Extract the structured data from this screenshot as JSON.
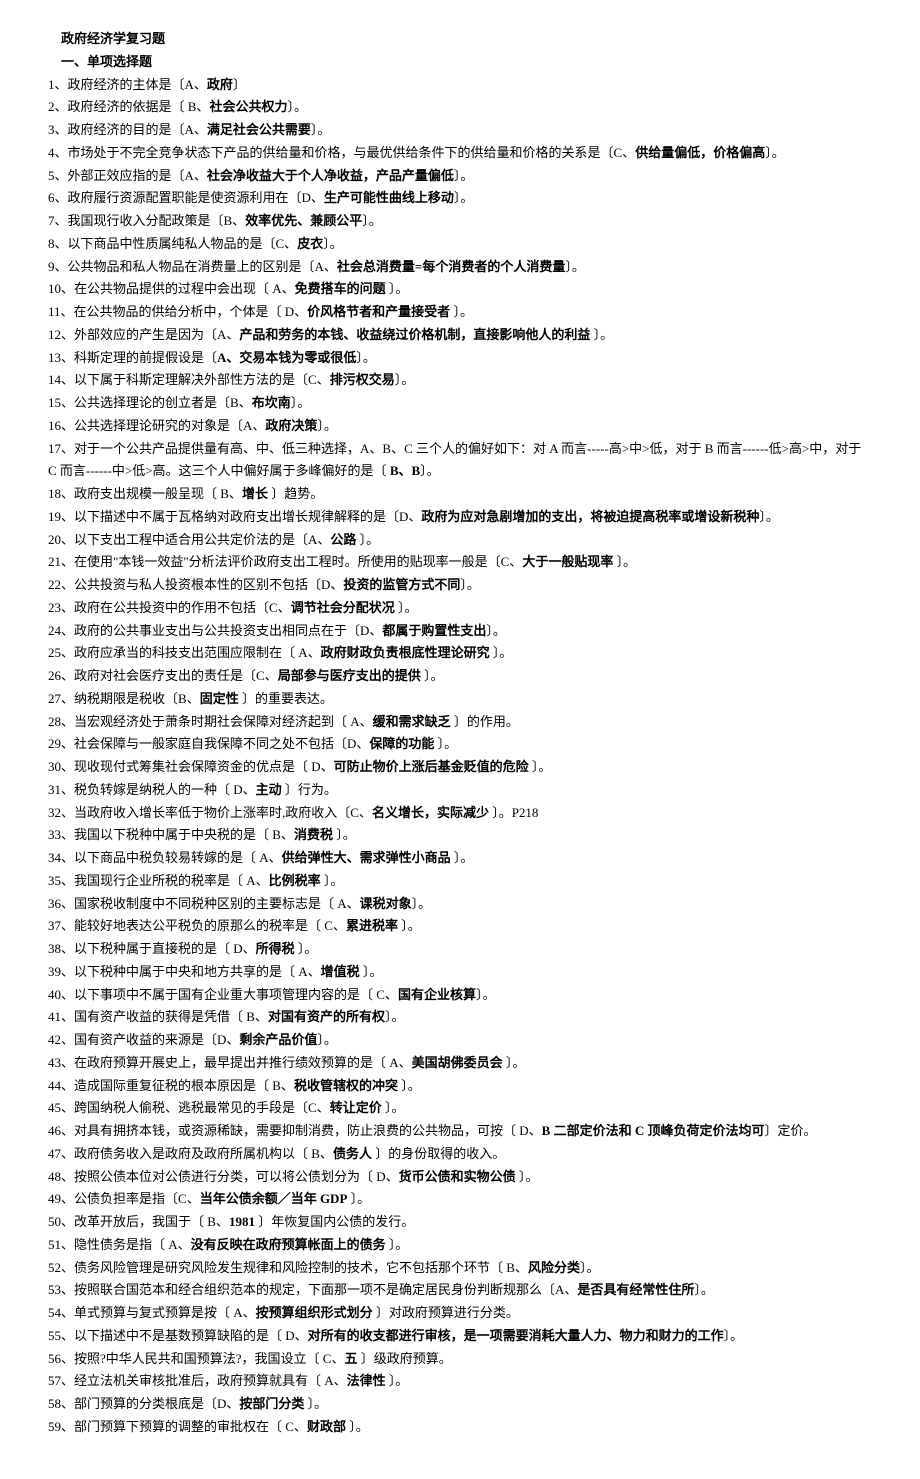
{
  "title": "政府经济学复习题",
  "section1": "一、单项选择题",
  "questions": [
    {
      "n": "1、",
      "pre": "政府经济的主体是〔A、",
      "ans": "政府",
      "post": "〕"
    },
    {
      "n": "2、",
      "pre": "政府经济的依据是〔  B、",
      "ans": "社会公共权力",
      "post": "〕。"
    },
    {
      "n": "3、",
      "pre": "政府经济的目的是〔A、",
      "ans": "满足社会公共需要",
      "post": "〕。"
    },
    {
      "n": "4、",
      "pre": "市场处于不完全竞争状态下产品的供给量和价格，与最优供给条件下的供给量和价格的关系是〔C、",
      "ans": "供给量偏低，价格偏高",
      "post": "〕。"
    },
    {
      "n": "5、",
      "pre": "外部正效应指的是〔A、",
      "ans": "社会净收益大于个人净收益，产品产量偏低",
      "post": "〕。"
    },
    {
      "n": "6、",
      "pre": "政府履行资源配置职能是使资源利用在〔D、",
      "ans": "生产可能性曲线上移动",
      "post": "〕。"
    },
    {
      "n": "7、",
      "pre": "我国现行收入分配政策是〔B、",
      "ans": "效率优先、兼顾公平",
      "post": "〕。"
    },
    {
      "n": "8、",
      "pre": "以下商品中性质属纯私人物品的是〔C、",
      "ans": "皮衣",
      "post": "〕。"
    },
    {
      "n": "9、",
      "pre": "公共物品和私人物品在消费量上的区别是〔A、",
      "ans": "社会总消费量=每个消费者的个人消费量",
      "post": "〕。"
    },
    {
      "n": "10、",
      "pre": "在公共物品提供的过程中会出现〔   A、",
      "ans": "免费搭车的问题",
      "post": "   〕。"
    },
    {
      "n": "11、",
      "pre": "在公共物品的供给分析中，个体是〔   D、",
      "ans": "价风格节者和产量接受者",
      "post": "   〕。"
    },
    {
      "n": "12、",
      "pre": "外部效应的产生是因为〔A、",
      "ans": "产品和劳务的本钱、收益绕过价格机制，直接影响他人的利益",
      "post": "   〕。"
    },
    {
      "n": "13、",
      "pre": "科斯定理的前提假设是〔",
      "ans": "A、交易本钱为零或很低",
      "post": "〕。"
    },
    {
      "n": "14、",
      "pre": "以下属于科斯定理解决外部性方法的是〔C、",
      "ans": "排污权交易",
      "post": "〕。"
    },
    {
      "n": "15、",
      "pre": "公共选择理论的创立者是〔B、",
      "ans": "布坎南",
      "post": "〕。"
    },
    {
      "n": "16、",
      "pre": "公共选择理论研究的对象是〔A、",
      "ans": "政府决策",
      "post": "〕。"
    },
    {
      "n": "17、",
      "pre": "对于一个公共产品提供量有高、中、低三种选择，A、B、C 三个人的偏好如下：对 A 而言-----高>中>低，对于 B 而言------低>高>中，对于 C 而言------中>低>高。这三个人中偏好属于多峰偏好的是〔   ",
      "ans": "B、B",
      "post": "〕。"
    },
    {
      "n": "18、",
      "pre": "政府支出规模一般呈现〔   B、",
      "ans": "增长",
      "post": "  〕趋势。"
    },
    {
      "n": "19、",
      "pre": "以下描述中不属于瓦格纳对政府支出增长规律解释的是〔D、",
      "ans": "政府为应对急剧增加的支出，将被迫提高税率或增设新税种",
      "post": "〕。"
    },
    {
      "n": "20、",
      "pre": "以下支出工程中适合用公共定价法的是〔A、",
      "ans": "公路",
      "post": "  〕。"
    },
    {
      "n": "21、",
      "pre": "在使用\"本钱一效益\"分析法评价政府支出工程时。所使用的贴现率一般是〔C、",
      "ans": "大于一般贴现率",
      "post": "  〕。"
    },
    {
      "n": "22、",
      "pre": "公共投资与私人投资根本性的区别不包括〔D、",
      "ans": "投资的监管方式不同",
      "post": "〕。"
    },
    {
      "n": "23、",
      "pre": "政府在公共投资中的作用不包括〔C、",
      "ans": "调节社会分配状况",
      "post": "  〕。"
    },
    {
      "n": "24、",
      "pre": "政府的公共事业支出与公共投资支出相同点在于〔D、",
      "ans": "都属于购置性支出",
      "post": "〕。"
    },
    {
      "n": "25、",
      "pre": "政府应承当的科技支出范围应限制在〔   A、",
      "ans": "政府财政负责根底性理论研究",
      "post": "  〕。"
    },
    {
      "n": "26、",
      "pre": "政府对社会医疗支出的责任是〔C、",
      "ans": "局部参与医疗支出的提供",
      "post": "   〕。"
    },
    {
      "n": "27、",
      "pre": "纳税期限是税收〔B、",
      "ans": "固定性",
      "post": "   〕的重要表达。"
    },
    {
      "n": "28、",
      "pre": "当宏观经济处于萧条时期社会保障对经济起到〔   A、",
      "ans": "缓和需求缺乏",
      "post": "     〕的作用。"
    },
    {
      "n": "29、",
      "pre": "社会保障与一般家庭自我保障不同之处不包括〔D、",
      "ans": "保障的功能",
      "post": "    〕。"
    },
    {
      "n": "30、",
      "pre": "现收现付式筹集社会保障资金的优点是〔   D、",
      "ans": "可防止物价上涨后基金贬值的危险",
      "post": "  〕。"
    },
    {
      "n": "31、",
      "pre": "税负转嫁是纳税人的一种〔    D、",
      "ans": "主动",
      "post": "   〕行为。"
    },
    {
      "n": "32、",
      "pre": "当政府收入增长率低于物价上涨率时,政府收入〔C、",
      "ans": "名义增长，实际减少",
      "post": "   〕。P218"
    },
    {
      "n": "33、",
      "pre": "我国以下税种中属于中央税的是〔   B、",
      "ans": "消费税",
      "post": "  〕。"
    },
    {
      "n": "34、",
      "pre": "以下商品中税负较易转嫁的是〔    A、",
      "ans": "供给弹性大、需求弹性小商品",
      "post": "   〕。"
    },
    {
      "n": "35、",
      "pre": "我国现行企业所税的税率是〔   A、",
      "ans": "比例税率",
      "post": "   〕。"
    },
    {
      "n": "36、",
      "pre": "国家税收制度中不同税种区别的主要标志是〔   A、",
      "ans": "课税对象",
      "post": "〕。"
    },
    {
      "n": "37、",
      "pre": "能较好地表达公平税负的原那么的税率是〔  C、",
      "ans": "累进税率",
      "post": "   〕。"
    },
    {
      "n": "38、",
      "pre": "以下税种属于直接税的是〔   D、",
      "ans": "所得税",
      "post": "   〕。"
    },
    {
      "n": "39、",
      "pre": "以下税种中属于中央和地方共享的是〔  A、",
      "ans": "增值税",
      "post": "   〕。"
    },
    {
      "n": "40、",
      "pre": "以下事项中不属于国有企业重大事项管理内容的是〔   C、",
      "ans": "国有企业核算",
      "post": "〕。"
    },
    {
      "n": "41、",
      "pre": "国有资产收益的获得是凭借〔   B、",
      "ans": "对国有资产的所有权",
      "post": "〕。"
    },
    {
      "n": "42、",
      "pre": "国有资产收益的来源是〔D、",
      "ans": "剩余产品价值",
      "post": "〕。"
    },
    {
      "n": "43、",
      "pre": "在政府预算开展史上，最早提出并推行绩效预算的是〔      A、",
      "ans": "美国胡佛委员会",
      "post": "     〕。"
    },
    {
      "n": "44、",
      "pre": "造成国际重复征税的根本原因是〔  B、",
      "ans": "税收管辖权的冲突",
      "post": "   〕。"
    },
    {
      "n": "45、",
      "pre": "跨国纳税人偷税、逃税最常见的手段是〔C、",
      "ans": "转让定价",
      "post": "   〕。"
    },
    {
      "n": "46、",
      "pre": "对具有拥挤本钱，或资源稀缺，需要抑制消费，防止浪费的公共物品，可按〔   D、",
      "ans": "B 二部定价法和 C 顶峰负荷定价法均可",
      "post": "〕定价。"
    },
    {
      "n": "47、",
      "pre": "政府债务收入是政府及政府所属机构以〔   B、",
      "ans": "债务人",
      "post": "   〕的身份取得的收入。"
    },
    {
      "n": "48、",
      "pre": "按照公债本位对公债进行分类，可以将公债划分为〔   D、",
      "ans": "货币公债和实物公债",
      "post": "    〕。"
    },
    {
      "n": "49、",
      "pre": "公债负担率是指〔C、",
      "ans": "当年公债余额／当年 GDP",
      "post": "   〕。"
    },
    {
      "n": "50、",
      "pre": "改革开放后，我国于〔   B、",
      "ans": "1981",
      "post": "   〕年恢复国内公债的发行。"
    },
    {
      "n": "51、",
      "pre": "隐性债务是指〔     A、",
      "ans": "没有反映在政府预算帐面上的债务",
      "post": "   〕。"
    },
    {
      "n": "52、",
      "pre": "债务风险管理是研究风险发生规律和风险控制的技术，它不包括那个环节〔   B、",
      "ans": "风险分类",
      "post": "〕。"
    },
    {
      "n": "53、",
      "pre": "按照联合国范本和经合组织范本的规定，下面那一项不是确定居民身份判断规那么〔A、",
      "ans": "是否具有经常性住所",
      "post": "〕。"
    },
    {
      "n": "54、",
      "pre": "单式预算与复式预算是按〔   A、",
      "ans": "按预算组织形式划分",
      "post": "   〕对政府预算进行分类。"
    },
    {
      "n": "55、",
      "pre": "以下描述中不是基数预算缺陷的是〔   D、",
      "ans": "对所有的收支都进行审核，是一项需要消耗大量人力、物力和财力的工作",
      "post": "〕。"
    },
    {
      "n": "56、",
      "pre": "按照?中华人民共和国预算法?，我国设立〔    C、",
      "ans": "五",
      "post": "   〕级政府预算。"
    },
    {
      "n": "57、",
      "pre": "经立法机关审核批准后，政府预算就具有〔      A、",
      "ans": "法律性",
      "post": "     〕。"
    },
    {
      "n": "58、",
      "pre": "部门预算的分类根底是〔D、",
      "ans": "按部门分类",
      "post": "   〕。"
    },
    {
      "n": "59、",
      "pre": "部门预算下预算的调整的审批权在〔  C、",
      "ans": "财政部",
      "post": "   〕。"
    }
  ]
}
